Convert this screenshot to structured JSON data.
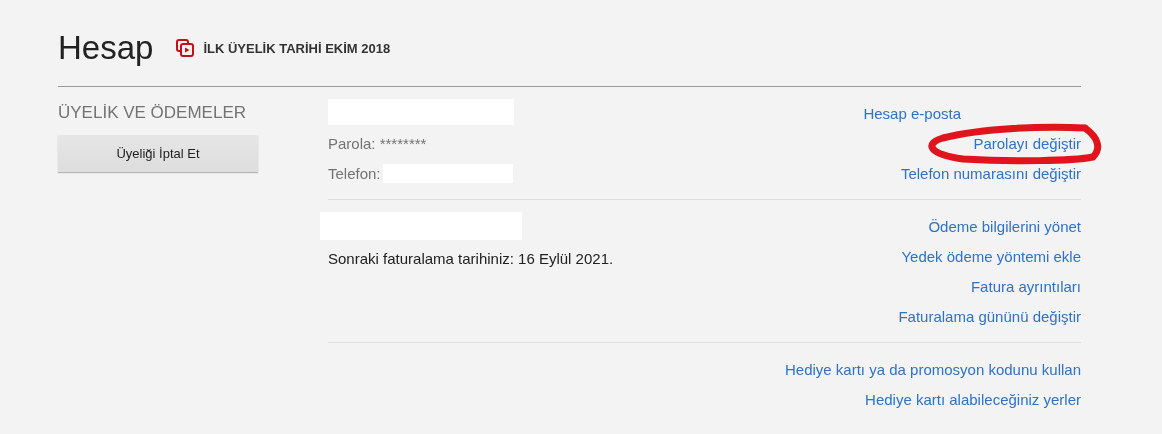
{
  "header": {
    "title": "Hesap",
    "member_since": "İLK ÜYELİK TARİHİ EKİM 2018"
  },
  "sidebar": {
    "heading": "ÜYELİK VE ÖDEMELER",
    "cancel_button": "Üyeliği İptal Et"
  },
  "sections": [
    {
      "info": [
        {
          "kind": "redacted"
        },
        {
          "kind": "text",
          "text": "Parola: ********"
        },
        {
          "kind": "labeled",
          "text": "Telefon:"
        }
      ],
      "links": [
        {
          "text": "Hesap e-posta",
          "circled": false
        },
        {
          "text": "Parolayı değiştir",
          "circled": true
        },
        {
          "text": "Telefon numarasını değiştir",
          "circled": false
        }
      ]
    },
    {
      "info": [
        {
          "kind": "redacted"
        },
        {
          "kind": "text",
          "text": "Sonraki faturalama tarihiniz: 16 Eylül 2021."
        }
      ],
      "links": [
        {
          "text": "Ödeme bilgilerini yönet",
          "circled": false
        },
        {
          "text": "Yedek ödeme yöntemi ekle",
          "circled": false
        },
        {
          "text": "Fatura ayrıntıları",
          "circled": false
        },
        {
          "text": "Faturalama gününü değiştir",
          "circled": false
        }
      ]
    },
    {
      "links": [
        {
          "text": "Hediye kartı ya da promosyon kodunu kullan",
          "circled": false
        },
        {
          "text": "Hediye kartı alabileceğiniz yerler",
          "circled": false
        }
      ]
    }
  ]
}
